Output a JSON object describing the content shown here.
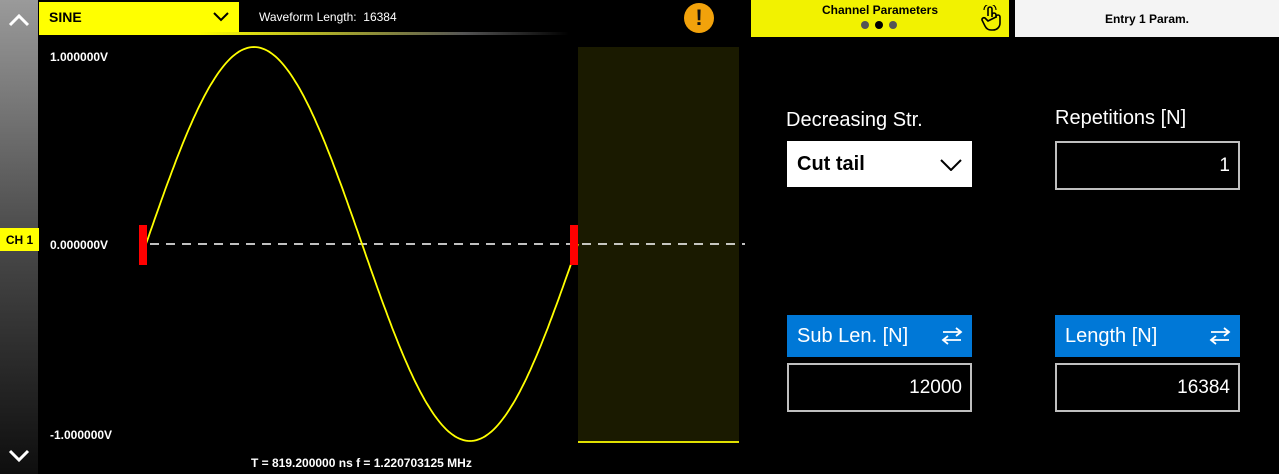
{
  "waveform": {
    "type_label": "SINE",
    "length_label": "Waveform Length:",
    "length_value": "16384"
  },
  "channel_badge": "CH 1",
  "tabs": {
    "channel_params": "Channel Parameters",
    "entry_params": "Entry  1  Param."
  },
  "plot": {
    "y_max_label": "1.000000V",
    "y_mid_label": "0.000000V",
    "y_min_label": "-1.000000V",
    "timing": "T =  819.200000 ns  f =  1.220703125 MHz"
  },
  "params": {
    "decreasing_label": "Decreasing Str.",
    "decreasing_value": "Cut tail",
    "repetitions_label": "Repetitions [N]",
    "repetitions_value": "1",
    "sub_len_label": "Sub Len. [N]",
    "sub_len_value": "12000",
    "length_label": "Length [N]",
    "length_value": "16384"
  },
  "colors": {
    "accent_yellow": "#ffff00",
    "button_blue": "#0078d7",
    "marker_red": "#ff0000",
    "warning_orange": "#f2a20b"
  },
  "icons": {
    "warning": "warning-icon",
    "hand": "touch-hand-icon",
    "swap": "swap-arrows-icon"
  }
}
